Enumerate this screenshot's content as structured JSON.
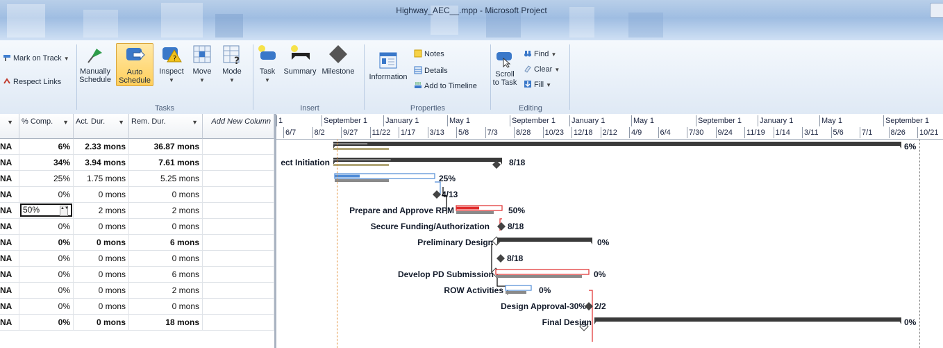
{
  "window": {
    "title": "Highway_AEC__.mpp - Microsoft Project"
  },
  "ribbon": {
    "track": {
      "mark_on_track": "Mark on Track",
      "respect_links": "Respect Links"
    },
    "tasks_group": {
      "label": "Tasks",
      "manually_schedule": [
        "Manually",
        "Schedule"
      ],
      "auto_schedule": [
        "Auto",
        "Schedule"
      ],
      "inspect": "Inspect",
      "move": "Move",
      "mode": "Mode"
    },
    "insert_group": {
      "label": "Insert",
      "task": "Task",
      "summary": "Summary",
      "milestone": "Milestone"
    },
    "properties_group": {
      "label": "Properties",
      "information": "Information",
      "notes": "Notes",
      "details": "Details",
      "add_to_timeline": "Add to Timeline"
    },
    "editing_group": {
      "label": "Editing",
      "scroll_to_task": [
        "Scroll",
        "to Task"
      ],
      "find": "Find",
      "clear": "Clear",
      "fill": "Fill"
    }
  },
  "grid": {
    "columns": [
      "% Comp.",
      "Act. Dur.",
      "Rem. Dur.",
      "Add New Column"
    ],
    "edit_value": "50%",
    "rows": [
      {
        "lead": "NA",
        "comp": "6%",
        "act": "2.33 mons",
        "rem": "36.87 mons",
        "bold": true
      },
      {
        "lead": "NA",
        "comp": "34%",
        "act": "3.94 mons",
        "rem": "7.61 mons",
        "bold": true
      },
      {
        "lead": "NA",
        "comp": "25%",
        "act": "1.75 mons",
        "rem": "5.25 mons",
        "bold": false
      },
      {
        "lead": "NA",
        "comp": "0%",
        "act": "0 mons",
        "rem": "0 mons",
        "bold": false
      },
      {
        "lead": "NA",
        "comp": "50%",
        "act": "2 mons",
        "rem": "2 mons",
        "bold": false,
        "editing": true
      },
      {
        "lead": "NA",
        "comp": "0%",
        "act": "0 mons",
        "rem": "0 mons",
        "bold": false
      },
      {
        "lead": "NA",
        "comp": "0%",
        "act": "0 mons",
        "rem": "6 mons",
        "bold": true
      },
      {
        "lead": "NA",
        "comp": "0%",
        "act": "0 mons",
        "rem": "0 mons",
        "bold": false
      },
      {
        "lead": "NA",
        "comp": "0%",
        "act": "0 mons",
        "rem": "6 mons",
        "bold": false
      },
      {
        "lead": "NA",
        "comp": "0%",
        "act": "0 mons",
        "rem": "2 mons",
        "bold": false
      },
      {
        "lead": "NA",
        "comp": "0%",
        "act": "0 mons",
        "rem": "0 mons",
        "bold": false
      },
      {
        "lead": "NA",
        "comp": "0%",
        "act": "0 mons",
        "rem": "18 mons",
        "bold": true
      }
    ]
  },
  "timescale": {
    "major": [
      "1",
      "September 1",
      "January 1",
      "May 1",
      "September 1",
      "January 1",
      "May 1",
      "September 1",
      "January 1",
      "May 1",
      "September 1"
    ],
    "minor": [
      "6/7",
      "8/2",
      "9/27",
      "11/22",
      "1/17",
      "3/13",
      "5/8",
      "7/3",
      "8/28",
      "10/23",
      "12/18",
      "2/12",
      "4/9",
      "6/4",
      "7/30",
      "9/24",
      "11/19",
      "1/14",
      "3/11",
      "5/6",
      "7/1",
      "8/26",
      "10/21"
    ]
  },
  "gantt": {
    "task_labels": [
      "ect Initiation",
      "Prepare and Approve RPM",
      "Secure Funding/Authorization",
      "Preliminary Design",
      "Develop PD Submission",
      "ROW Activities",
      "Design Approval-30%",
      "Final Design"
    ],
    "bar_labels": [
      "6%",
      "8/18",
      "25%",
      "4/13",
      "50%",
      "8/18",
      "0%",
      "8/18",
      "0%",
      "0%",
      "2/2",
      "0%"
    ],
    "progress": [
      0.06,
      0.34,
      0.25,
      0.0,
      0.5,
      0.0,
      0.0,
      0.0,
      0.0,
      0.0,
      0.0,
      0.0
    ],
    "colors": {
      "summary": "#3a3a3a",
      "baseline": "#b3a87a",
      "task": "#4f8bd6",
      "critical": "#e02b2b",
      "today_line": "#e08a2e"
    }
  }
}
